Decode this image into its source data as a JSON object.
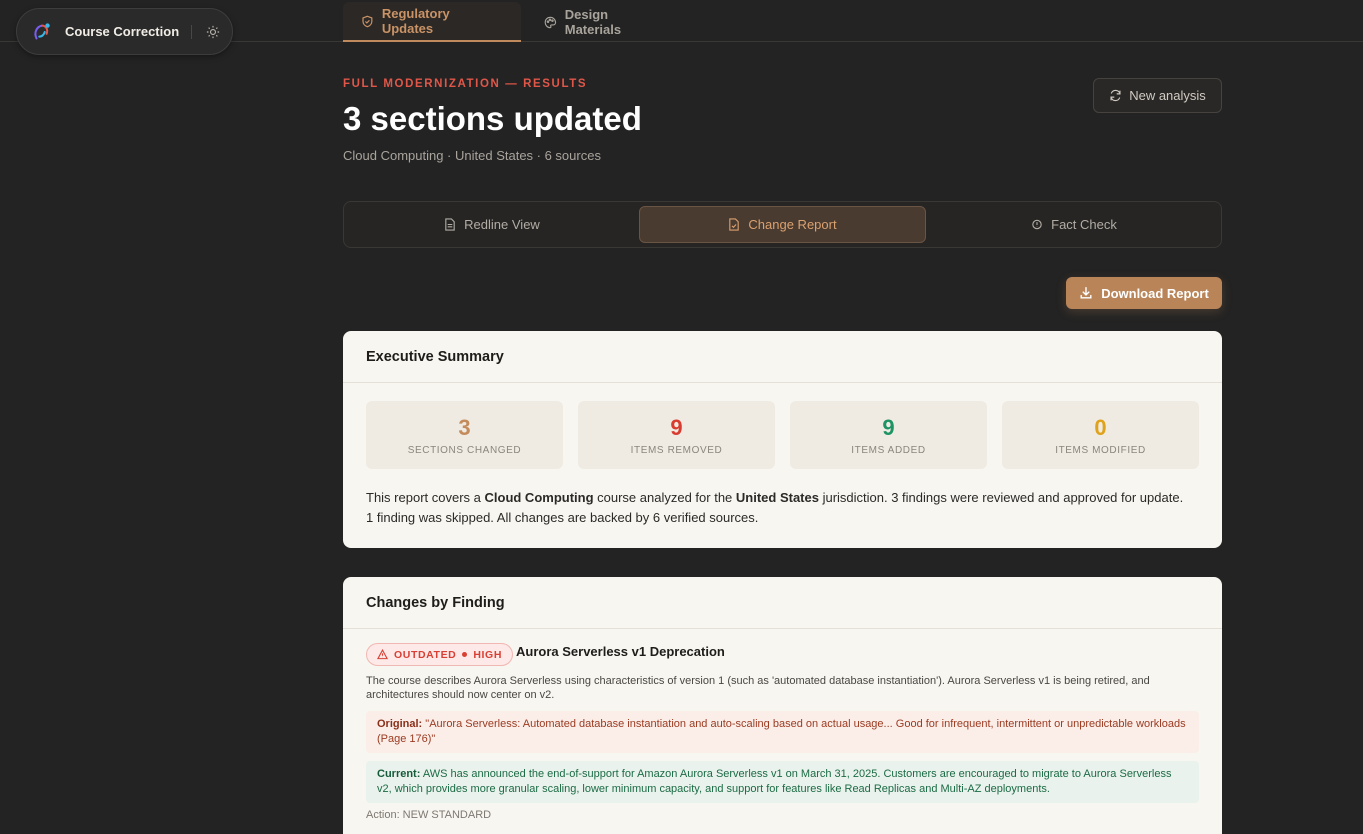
{
  "brand": {
    "name": "Course Correction",
    "logo_icon": "course-correction-logo",
    "theme_icon": "sun-icon"
  },
  "top_tabs": [
    {
      "label": "Regulatory Updates",
      "icon": "shield-check-icon",
      "active": true
    },
    {
      "label": "Design Materials",
      "icon": "palette-icon",
      "active": false
    }
  ],
  "header": {
    "eyebrow": "FULL MODERNIZATION — RESULTS",
    "title": "3 sections updated",
    "subtitle": "Cloud Computing · United States · 6 sources",
    "new_analysis_label": "New analysis"
  },
  "view_tabs": [
    {
      "label": "Redline View",
      "icon": "document-icon",
      "active": false
    },
    {
      "label": "Change Report",
      "icon": "report-icon",
      "active": true
    },
    {
      "label": "Fact Check",
      "icon": "shield-icon",
      "active": false
    }
  ],
  "download_label": "Download Report",
  "summary": {
    "heading": "Executive Summary",
    "stats": [
      {
        "value": "3",
        "label": "SECTIONS CHANGED",
        "color": "#c48b5c"
      },
      {
        "value": "9",
        "label": "ITEMS REMOVED",
        "color": "#d93b30"
      },
      {
        "value": "9",
        "label": "ITEMS ADDED",
        "color": "#1e9363"
      },
      {
        "value": "0",
        "label": "ITEMS MODIFIED",
        "color": "#e0a21a"
      }
    ],
    "text": {
      "p1": "This report covers a ",
      "course": "Cloud Computing",
      "p2": " course analyzed for the ",
      "jurisdiction": "United States",
      "p3": " jurisdiction. 3 findings were reviewed and approved for update. 1 finding was skipped. All changes are backed by 6 verified sources."
    }
  },
  "changes": {
    "heading": "Changes by Finding",
    "findings": [
      {
        "badge_type": "OUTDATED",
        "badge_severity": "HIGH",
        "title": "Aurora Serverless v1 Deprecation",
        "description": "The course describes Aurora Serverless using characteristics of version 1 (such as 'automated database instantiation'). Aurora Serverless v1 is being retired, and architectures should now center on v2.",
        "original_label": "Original:",
        "original_text": " \"Aurora Serverless: Automated database instantiation and auto-scaling based on actual usage... Good for infrequent, intermittent or unpredictable workloads (Page 176)\"",
        "current_label": "Current:",
        "current_text": " AWS has announced the end-of-support for Amazon Aurora Serverless v1 on March 31, 2025. Customers are encouraged to migrate to Aurora Serverless v2, which provides more granular scaling, lower minimum capacity, and support for features like Read Replicas and Multi-AZ deployments.",
        "action": "Action: NEW STANDARD"
      }
    ]
  }
}
